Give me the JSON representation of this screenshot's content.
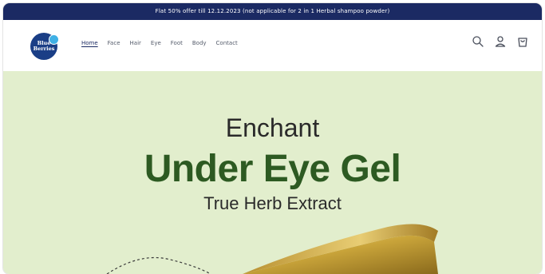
{
  "announcement": "Flat 50% offer till 12.12.2023 (not applicable for 2 in 1 Herbal shampoo powder)",
  "brand": {
    "line1": "Blue",
    "line2": "Berries"
  },
  "nav": {
    "items": [
      {
        "label": "Home"
      },
      {
        "label": "Face"
      },
      {
        "label": "Hair"
      },
      {
        "label": "Eye"
      },
      {
        "label": "Foot"
      },
      {
        "label": "Body"
      },
      {
        "label": "Contact"
      }
    ]
  },
  "header_icons": [
    "search-icon",
    "account-icon",
    "cart-icon"
  ],
  "hero": {
    "line1": "Enchant",
    "line2": "Under Eye Gel",
    "line3": "True Herb Extract"
  },
  "colors": {
    "announcement_bg": "#1b2a63",
    "hero_bg": "#e2eecd",
    "headline_green": "#2d5a22",
    "product_gold": "#c9a43a"
  }
}
